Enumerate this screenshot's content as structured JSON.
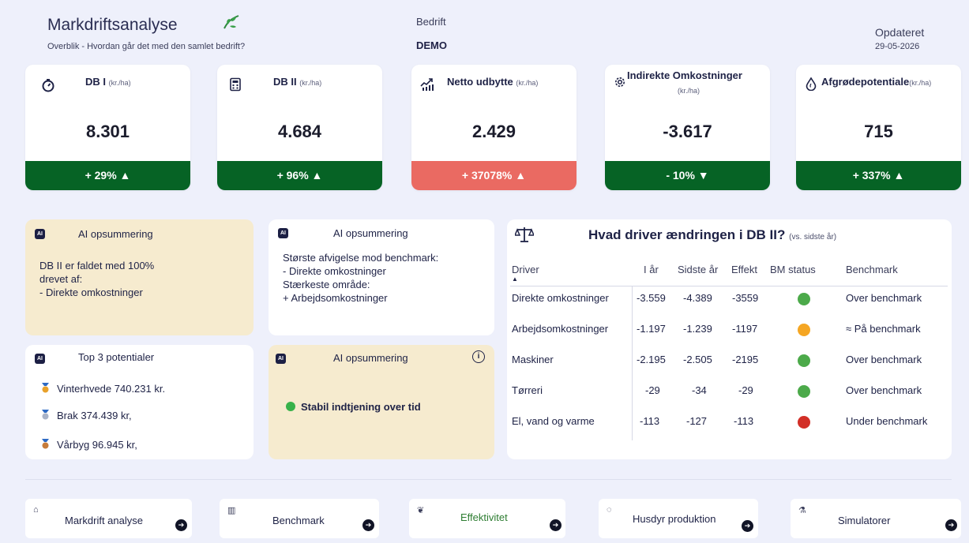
{
  "header": {
    "title": "Markdriftsanalyse",
    "subtitle": "Overblik - Hvordan går det med den samlet bedrift?",
    "company_label": "Bedrift",
    "company_value": "DEMO",
    "updated_label": "Opdateret",
    "updated_value": "29-05-2026"
  },
  "kpis": [
    {
      "title": "DB I",
      "unit": "(kr./ha)",
      "value": "8.301",
      "change": "+ 29% ▲",
      "icon": "stopwatch-icon",
      "status": "green"
    },
    {
      "title": "DB II",
      "unit": "(kr./ha)",
      "value": "4.684",
      "change": "+ 96% ▲",
      "icon": "calculator-icon",
      "status": "green"
    },
    {
      "title": "Netto udbytte",
      "unit": "(kr./ha)",
      "value": "2.429",
      "change": "+ 37078% ▲",
      "icon": "growth-chart-icon",
      "status": "red"
    },
    {
      "title": "Indirekte Omkostninger",
      "unit": "(kr./ha)",
      "value": "-3.617",
      "change": "- 10% ▼",
      "icon": "gear-icon",
      "status": "green"
    },
    {
      "title": "Afgrødepotentiale",
      "unit": "(kr./ha)",
      "value": "715",
      "change": "+ 337% ▲",
      "icon": "drop-icon",
      "status": "green"
    }
  ],
  "colors": {
    "green": "#066325",
    "red": "#ea6a62",
    "orange": "#f5a623",
    "dot_green": "#4caa4a",
    "dot_red": "#d22f27"
  },
  "ai1": {
    "title": "AI opsummering",
    "lines": [
      "DB II er faldet med 100%",
      "drevet af:",
      "- Direkte omkostninger"
    ]
  },
  "ai2": {
    "title": "AI opsummering",
    "lines": [
      "Største afvigelse mod benchmark:",
      "- Direkte omkostninger",
      "Stærkeste område:",
      "+ Arbejdsomkostninger"
    ]
  },
  "ai3": {
    "title": "AI opsummering",
    "text": "Stabil indtjening over tid"
  },
  "potentials": {
    "title": "Top 3 potentialer",
    "items": [
      "Vinterhvede 740.231 kr.",
      "Brak 374.439 kr,",
      "Vårbyg 96.945 kr,"
    ]
  },
  "driver_table": {
    "title": "Hvad driver ændringen i DB II?",
    "subtitle": "(vs. sidste år)",
    "headers": [
      "Driver",
      "I år",
      "Sidste år",
      "Effekt",
      "BM status",
      "Benchmark"
    ],
    "rows": [
      {
        "driver": "Direkte omkostninger",
        "this_year": "-3.559",
        "last_year": "-4.389",
        "effect": "-3559",
        "status": "green",
        "benchmark": "Over benchmark"
      },
      {
        "driver": "Arbejdsomkostninger",
        "this_year": "-1.197",
        "last_year": "-1.239",
        "effect": "-1197",
        "status": "orange",
        "benchmark": "≈ På benchmark"
      },
      {
        "driver": "Maskiner",
        "this_year": "-2.195",
        "last_year": "-2.505",
        "effect": "-2195",
        "status": "green",
        "benchmark": "Over benchmark"
      },
      {
        "driver": "Tørreri",
        "this_year": "-29",
        "last_year": "-34",
        "effect": "-29",
        "status": "green",
        "benchmark": "Over benchmark"
      },
      {
        "driver": "El, vand og varme",
        "this_year": "-113",
        "last_year": "-127",
        "effect": "-113",
        "status": "red",
        "benchmark": "Under benchmark"
      }
    ]
  },
  "nav": [
    {
      "label": "Markdrift analyse",
      "icon": "field-icon"
    },
    {
      "label": "Benchmark",
      "icon": "bar-chart-icon"
    },
    {
      "label": "Effektivitet",
      "icon": "leaf-icon"
    },
    {
      "label": "Husdyr produktion",
      "icon": "chat-icon"
    },
    {
      "label": "Simulatorer",
      "icon": "flask-icon"
    }
  ]
}
